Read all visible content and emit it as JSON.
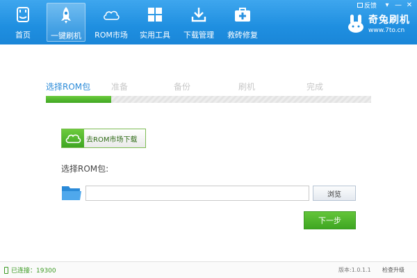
{
  "header": {
    "nav": [
      {
        "label": "首页",
        "icon": "home-icon"
      },
      {
        "label": "一键刷机",
        "icon": "rocket-icon",
        "active": true
      },
      {
        "label": "ROM市场",
        "icon": "cloud-icon"
      },
      {
        "label": "实用工具",
        "icon": "windows-icon"
      },
      {
        "label": "下载管理",
        "icon": "download-icon"
      },
      {
        "label": "救砖修复",
        "icon": "first-aid-icon"
      }
    ],
    "brand": {
      "name": "奇兔刷机",
      "url": "www.7to.cn"
    },
    "feedback_label": "反馈",
    "window_buttons": {
      "dropdown": "▾",
      "minimize": "—",
      "close": "✕"
    }
  },
  "steps": {
    "items": [
      "选择ROM包",
      "准备",
      "备份",
      "刷机",
      "完成"
    ],
    "active_index": 0,
    "progress": 0.2
  },
  "main": {
    "market_button_label": "去ROM市场下载",
    "rom_label": "选择ROM包:",
    "rom_input_value": "",
    "browse_label": "浏览",
    "next_label": "下一步"
  },
  "status": {
    "connection": "已连接：19300",
    "version": "版本:1.0.1.1",
    "upgrade": "检查升级"
  },
  "colors": {
    "header_blue": "#1f8fe0",
    "accent_green": "#3fa622",
    "step_active": "#2a8ad8"
  }
}
